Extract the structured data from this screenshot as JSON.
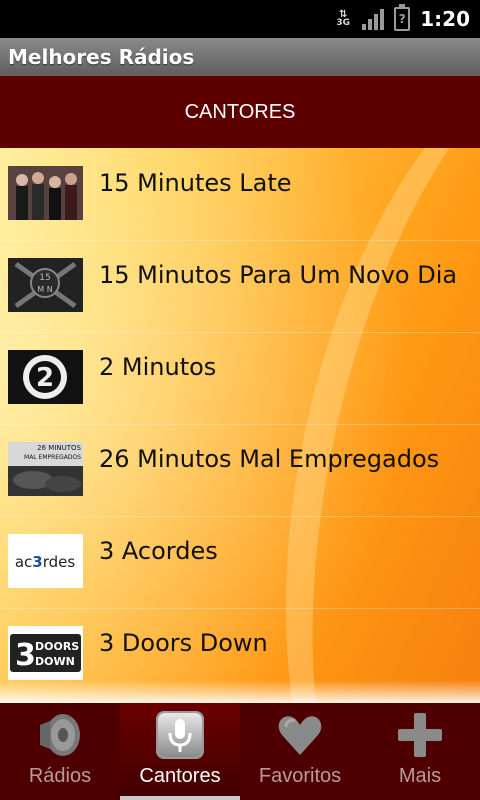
{
  "status_bar": {
    "network": "3G",
    "time": "1:20"
  },
  "app": {
    "title": "Melhores Rádios"
  },
  "section": {
    "title": "CANTORES"
  },
  "artists": [
    {
      "name": "15 Minutes Late"
    },
    {
      "name": "15 Minutos Para Um Novo Dia",
      "thumb_text": "15\nM N"
    },
    {
      "name": "2 Minutos",
      "thumb_text": "2"
    },
    {
      "name": "26 Minutos Mal Empregados",
      "thumb_text": "26 MINUTOS\nMAL EMPREGADOS"
    },
    {
      "name": "3 Acordes",
      "thumb_text": "ac3rdes"
    },
    {
      "name": "3 Doors Down",
      "thumb_text": "3 DOORS\nDOWN"
    }
  ],
  "tabs": [
    {
      "label": "Rádios",
      "icon": "speaker-icon",
      "active": false
    },
    {
      "label": "Cantores",
      "icon": "microphone-icon",
      "active": true
    },
    {
      "label": "Favoritos",
      "icon": "heart-icon",
      "active": false
    },
    {
      "label": "Mais",
      "icon": "plus-icon",
      "active": false
    }
  ],
  "colors": {
    "header_bg": "#5c0000",
    "tabbar_bg": "#4e0000",
    "list_bg": "#ffb02d"
  }
}
